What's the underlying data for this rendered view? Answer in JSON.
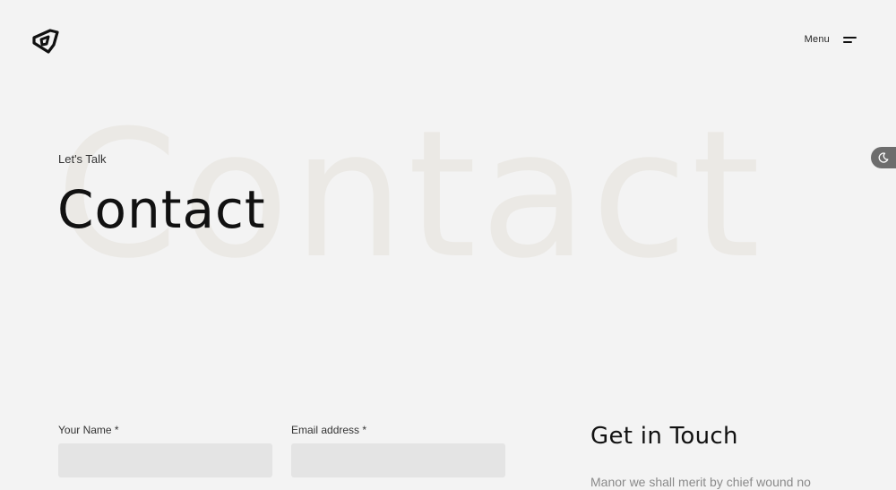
{
  "header": {
    "logo_icon": "brand-logo-icon",
    "menu_label": "Menu",
    "menu_icon": "hamburger-icon"
  },
  "theme_toggle": {
    "icon": "moon-icon",
    "color": "#6d6d6d"
  },
  "hero": {
    "background_word": "Contact",
    "subtitle": "Let's Talk",
    "title": "Contact"
  },
  "form": {
    "name_label": "Your Name *",
    "name_value": "",
    "email_label": "Email address *",
    "email_value": ""
  },
  "get_in_touch": {
    "title": "Get in Touch",
    "text": "Manor we shall merit by chief wound no"
  },
  "colors": {
    "background": "#f3f3f3",
    "input_background": "#e4e4e4",
    "watermark": "#ebe9e5",
    "muted_text": "#8a8a8a"
  }
}
